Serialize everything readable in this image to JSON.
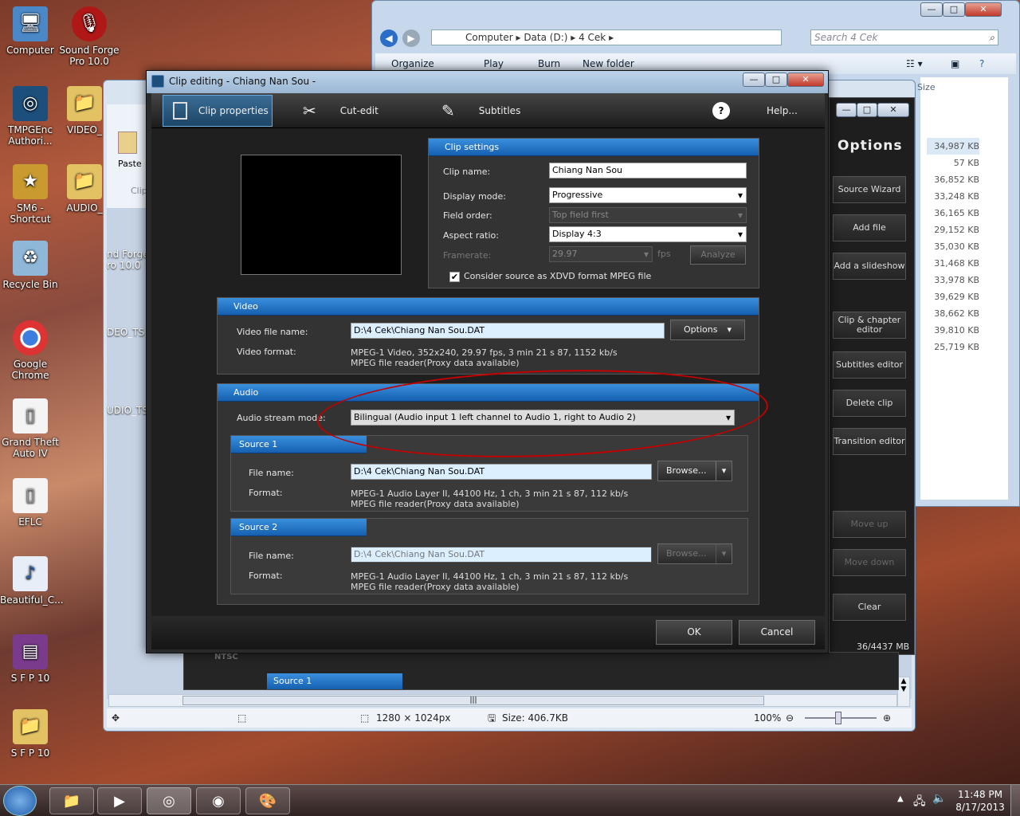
{
  "desktop": {
    "icons": [
      {
        "label": "Computer"
      },
      {
        "label": "Sound Forge Pro 10.0"
      },
      {
        "label": "TMPGEnc Authori..."
      },
      {
        "label": "VIDEO_"
      },
      {
        "label": "SM6 - Shortcut"
      },
      {
        "label": "AUDIO_"
      },
      {
        "label": "Recycle Bin"
      },
      {
        "label": "Google Chrome"
      },
      {
        "label": "Grand Theft Auto IV"
      },
      {
        "label": "EFLC"
      },
      {
        "label": "Beautiful_C..."
      },
      {
        "label": "S F P 10"
      },
      {
        "label": "S F P 10"
      }
    ],
    "partial": {
      "forge": "nd Forge",
      "forge2": "ro 10.0",
      "deo": "DEO_TS",
      "udio": "UDIO_TS"
    }
  },
  "explorer": {
    "breadcrumb": [
      "Computer",
      "Data (D:)",
      "4 Cek"
    ],
    "search_placeholder": "Search 4 Cek",
    "toolbar": [
      "Organize",
      "Play",
      "Burn",
      "New folder"
    ],
    "col_size": "Size",
    "sizes": [
      "34,987 KB",
      "57 KB",
      "36,852 KB",
      "33,248 KB",
      "36,165 KB",
      "29,152 KB",
      "35,030 KB",
      "31,468 KB",
      "33,978 KB",
      "39,629 KB",
      "38,662 KB",
      "39,810 KB",
      "25,719 KB"
    ]
  },
  "paint": {
    "paste": "Paste",
    "clip": "Clip",
    "status": {
      "dims": "1280 × 1024px",
      "size": "Size: 406.7KB",
      "zoom": "100%"
    }
  },
  "options_panel": {
    "title": "Options",
    "buttons": [
      "Source Wizard",
      "Add file",
      "Add a slideshow",
      "Clip & chapter editor",
      "Subtitles editor",
      "Delete clip",
      "Transition editor",
      "Move up",
      "Move down",
      "Clear"
    ],
    "usage": "36/4437 MB",
    "nisc": "NTSC",
    "source_bar": "Source 1"
  },
  "dialog": {
    "title": "Clip editing - Chiang Nan Sou -",
    "tabs": [
      "Clip properties",
      "Cut-edit",
      "Subtitles",
      "Help..."
    ],
    "clip_settings": {
      "header": "Clip settings",
      "clip_name_label": "Clip name:",
      "clip_name": "Chiang Nan Sou",
      "display_mode_label": "Display mode:",
      "display_mode": "Progressive",
      "field_order_label": "Field order:",
      "field_order": "Top field first",
      "aspect_label": "Aspect ratio:",
      "aspect": "Display 4:3",
      "framerate_label": "Framerate:",
      "framerate": "29.97",
      "fps": "fps",
      "analyze": "Analyze",
      "xdvd": "Consider source as XDVD format MPEG file"
    },
    "video": {
      "header": "Video",
      "file_label": "Video file name:",
      "file": "D:\\4 Cek\\Chiang Nan Sou.DAT",
      "options": "Options",
      "format_label": "Video format:",
      "format_line1": "MPEG-1 Video,  352x240,  29.97  fps,  3 min 21 s 87,  1152  kb/s",
      "format_line2": "MPEG file reader(Proxy data available)"
    },
    "audio": {
      "header": "Audio",
      "mode_label": "Audio stream mode:",
      "mode": "Bilingual (Audio input 1 left channel to Audio 1, right to Audio 2)",
      "source1": {
        "header": "Source 1",
        "file_label": "File name:",
        "file": "D:\\4 Cek\\Chiang Nan Sou.DAT",
        "browse": "Browse...",
        "format_label": "Format:",
        "line1": "MPEG-1 Audio Layer II,  44100  Hz,  1  ch,  3 min 21 s 87,  112  kb/s",
        "line2": "MPEG file reader(Proxy data available)"
      },
      "source2": {
        "header": "Source 2",
        "file_label": "File name:",
        "file": "D:\\4 Cek\\Chiang Nan Sou.DAT",
        "browse": "Browse...",
        "format_label": "Format:",
        "line1": "MPEG-1 Audio Layer II,  44100  Hz,  1  ch,  3 min 21 s 87,  112  kb/s",
        "line2": "MPEG file reader(Proxy data available)"
      }
    },
    "ok": "OK",
    "cancel": "Cancel"
  },
  "taskbar": {
    "time": "11:48 PM",
    "date": "8/17/2013"
  }
}
